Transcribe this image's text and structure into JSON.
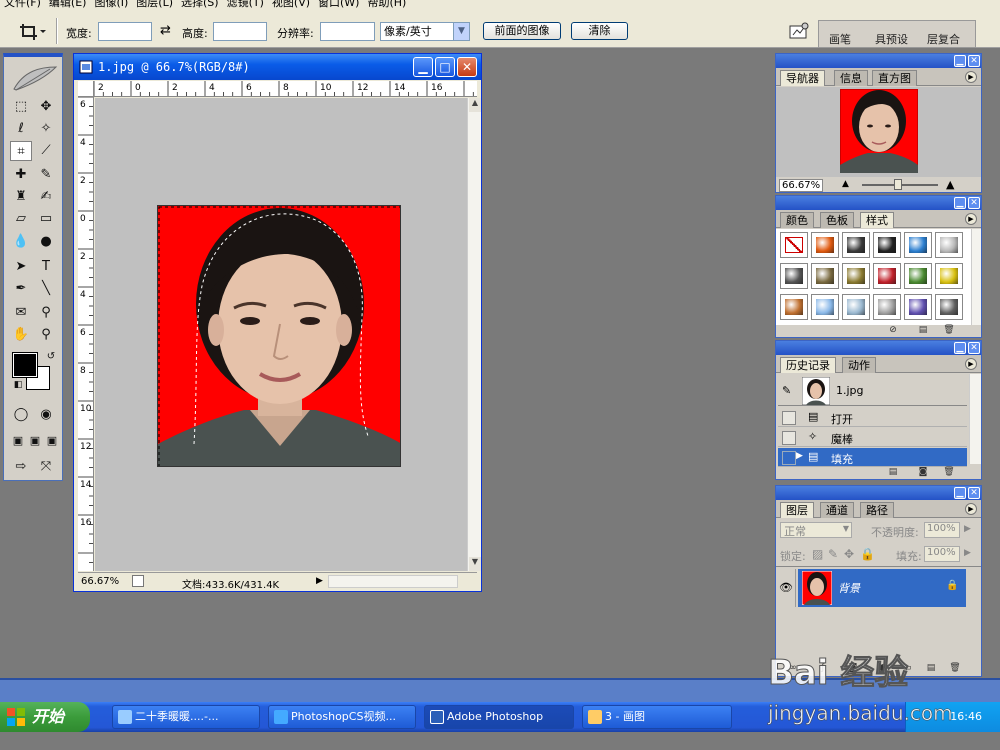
{
  "menu": [
    "文件(F)",
    "编辑(E)",
    "图像(I)",
    "图层(L)",
    "选择(S)",
    "滤镜(T)",
    "视图(V)",
    "窗口(W)",
    "帮助(H)"
  ],
  "options": {
    "width_label": "宽度:",
    "height_label": "高度:",
    "resolution_label": "分辨率:",
    "unit_value": "像素/英寸",
    "front_image_button": "前面的图像",
    "clear_button": "清除",
    "palette_well_tabs": [
      "画笔",
      "具预设",
      "层复合"
    ]
  },
  "document": {
    "title": "1.jpg @ 66.7%(RGB/8#)",
    "ruler_top": [
      "2",
      "0",
      "2",
      "4",
      "6",
      "8",
      "10",
      "12",
      "14",
      "16"
    ],
    "ruler_left": [
      "6",
      "4",
      "2",
      "0",
      "2",
      "4",
      "6",
      "8",
      "10",
      "12",
      "14",
      "16"
    ],
    "zoom": "66.67%",
    "doc_size": "文档:433.6K/431.4K"
  },
  "navigator": {
    "tabs": [
      "导航器",
      "信息",
      "直方图"
    ],
    "zoom": "66.67%"
  },
  "styles": {
    "tabs": [
      "颜色",
      "色板",
      "样式"
    ],
    "swatches": [
      "#ffffff",
      "#e05a10",
      "#3a3a3a",
      "#222222",
      "#2c7fd0",
      "#b8b8b8",
      "#555555",
      "#7a6a40",
      "#8a7a30",
      "#c0202a",
      "#4a8a30",
      "#d8c010",
      "#c07030",
      "#8ab8e8",
      "#9ab8d0",
      "#a0a0a0",
      "#6050b0",
      "#606060"
    ]
  },
  "history": {
    "tabs": [
      "历史记录",
      "动作"
    ],
    "snapshot": "1.jpg",
    "items": [
      "打开",
      "魔棒",
      "填充"
    ]
  },
  "layers": {
    "tabs": [
      "图层",
      "通道",
      "路径"
    ],
    "blend_mode": "正常",
    "opacity_label": "不透明度:",
    "opacity_value": "100%",
    "lock_label": "锁定:",
    "fill_label": "填充:",
    "fill_value": "100%",
    "layer_name": "背景"
  },
  "taskbar": {
    "start": "开始",
    "tasks": [
      "二十季暖暖....-...",
      "PhotoshopCS视频...",
      "Adobe Photoshop",
      "3 - 画图"
    ],
    "clock": "16:46"
  },
  "watermark": {
    "brand": "Bai 经验",
    "url": "jingyan.baidu.com"
  },
  "colors": {
    "background_red": "#ff0000",
    "xp_blue": "#0a5ce8",
    "canvas_gray": "#c0c0c0",
    "workspace_gray": "#7a7a7a"
  }
}
